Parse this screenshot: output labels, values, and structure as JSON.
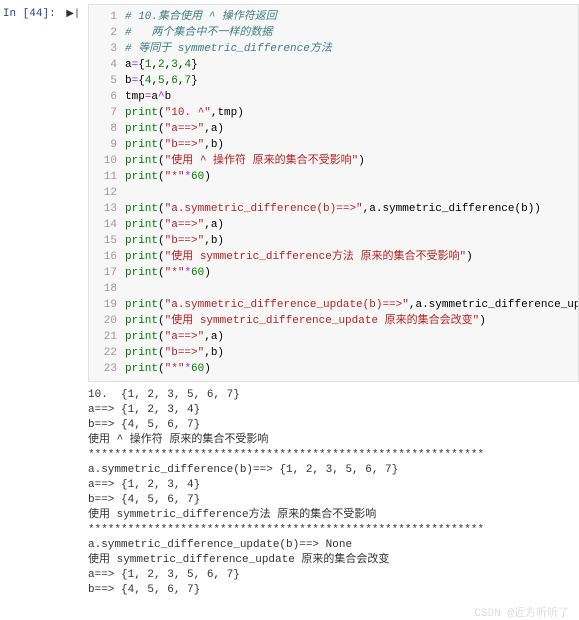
{
  "prompt": "In [44]:",
  "code": [
    {
      "n": 1,
      "segs": [
        {
          "cls": "c-comment",
          "t": "# 10.集合使用 ^ 操作符返回"
        }
      ]
    },
    {
      "n": 2,
      "segs": [
        {
          "cls": "c-comment",
          "t": "#   两个集合中不一样的数据"
        }
      ]
    },
    {
      "n": 3,
      "segs": [
        {
          "cls": "c-comment",
          "t": "# 等同于 symmetric_difference方法"
        }
      ]
    },
    {
      "n": 4,
      "segs": [
        {
          "cls": "c-name",
          "t": "a"
        },
        {
          "cls": "c-op",
          "t": "="
        },
        {
          "cls": "c-name",
          "t": "{"
        },
        {
          "cls": "c-num",
          "t": "1"
        },
        {
          "cls": "c-name",
          "t": ","
        },
        {
          "cls": "c-num",
          "t": "2"
        },
        {
          "cls": "c-name",
          "t": ","
        },
        {
          "cls": "c-num",
          "t": "3"
        },
        {
          "cls": "c-name",
          "t": ","
        },
        {
          "cls": "c-num",
          "t": "4"
        },
        {
          "cls": "c-name",
          "t": "}"
        }
      ]
    },
    {
      "n": 5,
      "segs": [
        {
          "cls": "c-name",
          "t": "b"
        },
        {
          "cls": "c-op",
          "t": "="
        },
        {
          "cls": "c-name",
          "t": "{"
        },
        {
          "cls": "c-num",
          "t": "4"
        },
        {
          "cls": "c-name",
          "t": ","
        },
        {
          "cls": "c-num",
          "t": "5"
        },
        {
          "cls": "c-name",
          "t": ","
        },
        {
          "cls": "c-num",
          "t": "6"
        },
        {
          "cls": "c-name",
          "t": ","
        },
        {
          "cls": "c-num",
          "t": "7"
        },
        {
          "cls": "c-name",
          "t": "}"
        }
      ]
    },
    {
      "n": 6,
      "segs": [
        {
          "cls": "c-name",
          "t": "tmp"
        },
        {
          "cls": "c-op",
          "t": "="
        },
        {
          "cls": "c-name",
          "t": "a"
        },
        {
          "cls": "c-op",
          "t": "^"
        },
        {
          "cls": "c-name",
          "t": "b"
        }
      ]
    },
    {
      "n": 7,
      "segs": [
        {
          "cls": "c-builtin",
          "t": "print"
        },
        {
          "cls": "c-name",
          "t": "("
        },
        {
          "cls": "c-str",
          "t": "\"10. ^\""
        },
        {
          "cls": "c-name",
          "t": ",tmp)"
        }
      ]
    },
    {
      "n": 8,
      "segs": [
        {
          "cls": "c-builtin",
          "t": "print"
        },
        {
          "cls": "c-name",
          "t": "("
        },
        {
          "cls": "c-str",
          "t": "\"a==>\""
        },
        {
          "cls": "c-name",
          "t": ",a)"
        }
      ]
    },
    {
      "n": 9,
      "segs": [
        {
          "cls": "c-builtin",
          "t": "print"
        },
        {
          "cls": "c-name",
          "t": "("
        },
        {
          "cls": "c-str",
          "t": "\"b==>\""
        },
        {
          "cls": "c-name",
          "t": ",b)"
        }
      ]
    },
    {
      "n": 10,
      "segs": [
        {
          "cls": "c-builtin",
          "t": "print"
        },
        {
          "cls": "c-name",
          "t": "("
        },
        {
          "cls": "c-str",
          "t": "\"使用 ^ 操作符 原来的集合不受影响\""
        },
        {
          "cls": "c-name",
          "t": ")"
        }
      ]
    },
    {
      "n": 11,
      "segs": [
        {
          "cls": "c-builtin",
          "t": "print"
        },
        {
          "cls": "c-name",
          "t": "("
        },
        {
          "cls": "c-str",
          "t": "\"*\""
        },
        {
          "cls": "c-op",
          "t": "*"
        },
        {
          "cls": "c-num",
          "t": "60"
        },
        {
          "cls": "c-name",
          "t": ")"
        }
      ]
    },
    {
      "n": 12,
      "segs": []
    },
    {
      "n": 13,
      "segs": [
        {
          "cls": "c-builtin",
          "t": "print"
        },
        {
          "cls": "c-name",
          "t": "("
        },
        {
          "cls": "c-str",
          "t": "\"a.symmetric_difference(b)==>\""
        },
        {
          "cls": "c-name",
          "t": ",a.symmetric_difference(b))"
        }
      ]
    },
    {
      "n": 14,
      "segs": [
        {
          "cls": "c-builtin",
          "t": "print"
        },
        {
          "cls": "c-name",
          "t": "("
        },
        {
          "cls": "c-str",
          "t": "\"a==>\""
        },
        {
          "cls": "c-name",
          "t": ",a)"
        }
      ]
    },
    {
      "n": 15,
      "segs": [
        {
          "cls": "c-builtin",
          "t": "print"
        },
        {
          "cls": "c-name",
          "t": "("
        },
        {
          "cls": "c-str",
          "t": "\"b==>\""
        },
        {
          "cls": "c-name",
          "t": ",b)"
        }
      ]
    },
    {
      "n": 16,
      "segs": [
        {
          "cls": "c-builtin",
          "t": "print"
        },
        {
          "cls": "c-name",
          "t": "("
        },
        {
          "cls": "c-str",
          "t": "\"使用 symmetric_difference方法 原来的集合不受影响\""
        },
        {
          "cls": "c-name",
          "t": ")"
        }
      ]
    },
    {
      "n": 17,
      "segs": [
        {
          "cls": "c-builtin",
          "t": "print"
        },
        {
          "cls": "c-name",
          "t": "("
        },
        {
          "cls": "c-str",
          "t": "\"*\""
        },
        {
          "cls": "c-op",
          "t": "*"
        },
        {
          "cls": "c-num",
          "t": "60"
        },
        {
          "cls": "c-name",
          "t": ")"
        }
      ]
    },
    {
      "n": 18,
      "segs": []
    },
    {
      "n": 19,
      "segs": [
        {
          "cls": "c-builtin",
          "t": "print"
        },
        {
          "cls": "c-name",
          "t": "("
        },
        {
          "cls": "c-str",
          "t": "\"a.symmetric_difference_update(b)==>\""
        },
        {
          "cls": "c-name",
          "t": ",a.symmetric_difference_up"
        }
      ]
    },
    {
      "n": 20,
      "segs": [
        {
          "cls": "c-builtin",
          "t": "print"
        },
        {
          "cls": "c-name",
          "t": "("
        },
        {
          "cls": "c-str",
          "t": "\"使用 symmetric_difference_update 原来的集合会改变\""
        },
        {
          "cls": "c-name",
          "t": ")"
        }
      ]
    },
    {
      "n": 21,
      "segs": [
        {
          "cls": "c-builtin",
          "t": "print"
        },
        {
          "cls": "c-name",
          "t": "("
        },
        {
          "cls": "c-str",
          "t": "\"a==>\""
        },
        {
          "cls": "c-name",
          "t": ",a)"
        }
      ]
    },
    {
      "n": 22,
      "segs": [
        {
          "cls": "c-builtin",
          "t": "print"
        },
        {
          "cls": "c-name",
          "t": "("
        },
        {
          "cls": "c-str",
          "t": "\"b==>\""
        },
        {
          "cls": "c-name",
          "t": ",b)"
        }
      ]
    },
    {
      "n": 23,
      "segs": [
        {
          "cls": "c-builtin",
          "t": "print"
        },
        {
          "cls": "c-name",
          "t": "("
        },
        {
          "cls": "c-str",
          "t": "\"*\""
        },
        {
          "cls": "c-op",
          "t": "*"
        },
        {
          "cls": "c-num",
          "t": "60"
        },
        {
          "cls": "c-name",
          "t": ")"
        }
      ]
    }
  ],
  "output": [
    "10.  {1, 2, 3, 5, 6, 7}",
    "a==> {1, 2, 3, 4}",
    "b==> {4, 5, 6, 7}",
    "使用 ^ 操作符 原来的集合不受影响",
    "************************************************************",
    "a.symmetric_difference(b)==> {1, 2, 3, 5, 6, 7}",
    "a==> {1, 2, 3, 4}",
    "b==> {4, 5, 6, 7}",
    "使用 symmetric_difference方法 原来的集合不受影响",
    "************************************************************",
    "a.symmetric_difference_update(b)==> None",
    "使用 symmetric_difference_update 原来的集合会改变",
    "a==> {1, 2, 3, 5, 6, 7}",
    "b==> {4, 5, 6, 7}"
  ],
  "watermark": "CSDN @近方听听了"
}
